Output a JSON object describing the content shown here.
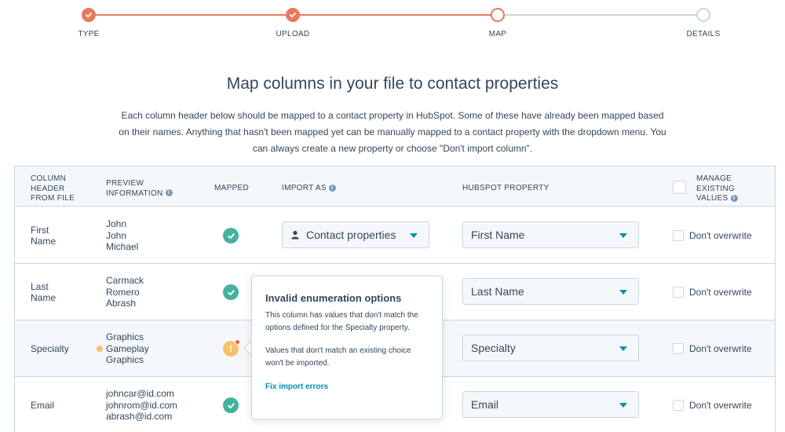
{
  "colors": {
    "accent_orange": "#e9785d",
    "step_inactive": "#cbd6e2",
    "mapped_green": "#45b29d",
    "warning_yellow": "#f5c26b",
    "error_red": "#f2545b",
    "link_blue": "#0091ae",
    "text": "#33475b"
  },
  "stepper": {
    "steps": [
      {
        "label": "TYPE",
        "state": "done"
      },
      {
        "label": "UPLOAD",
        "state": "done"
      },
      {
        "label": "MAP",
        "state": "current"
      },
      {
        "label": "DETAILS",
        "state": "todo"
      }
    ]
  },
  "header": {
    "title": "Map columns in your file to contact properties",
    "description": "Each column header below should be mapped to a contact property in HubSpot. Some of these have already been mapped based on their names. Anything that hasn't been mapped yet can be manually mapped to a contact property with the dropdown menu. You can always create a new property or choose \"Don't import column\"."
  },
  "table": {
    "headers": {
      "column_header": [
        "COLUMN",
        "HEADER",
        "FROM FILE"
      ],
      "preview": [
        "PREVIEW",
        "INFORMATION"
      ],
      "mapped": "MAPPED",
      "import_as": "IMPORT AS",
      "hubspot_property": "HUBSPOT PROPERTY",
      "manage": [
        "MANAGE",
        "EXISTING",
        "VALUES"
      ]
    },
    "rows": [
      {
        "column": [
          "First",
          "Name"
        ],
        "preview": [
          "John",
          "John",
          "Michael"
        ],
        "mapped": "check-icon",
        "import_as": "Contact properties",
        "property": "First Name",
        "overwrite": "Don't overwrite"
      },
      {
        "column": [
          "Last",
          "Name"
        ],
        "preview": [
          "Carmack",
          "Romero",
          "Abrash"
        ],
        "mapped": "check-icon",
        "import_as": "",
        "property": "Last Name",
        "overwrite": "Don't overwrite"
      },
      {
        "column": [
          "Specialty"
        ],
        "preview": [
          "Graphics",
          "Gameplay",
          "Graphics"
        ],
        "mapped": "warning-icon",
        "import_as": "",
        "property": "Specialty",
        "overwrite": "Don't overwrite"
      },
      {
        "column": [
          "Email"
        ],
        "preview": [
          "johncar@id.com",
          "johnrom@id.com",
          "abrash@id.com"
        ],
        "mapped": "check-icon",
        "import_as": "",
        "property": "Email",
        "overwrite": "Don't overwrite"
      }
    ]
  },
  "popover": {
    "title": "Invalid enumeration options",
    "text1": "This column has values that don't match the options defined for the Specialty property.",
    "text2": "Values that don't match an existing choice won't be imported.",
    "link": "Fix import errors"
  }
}
